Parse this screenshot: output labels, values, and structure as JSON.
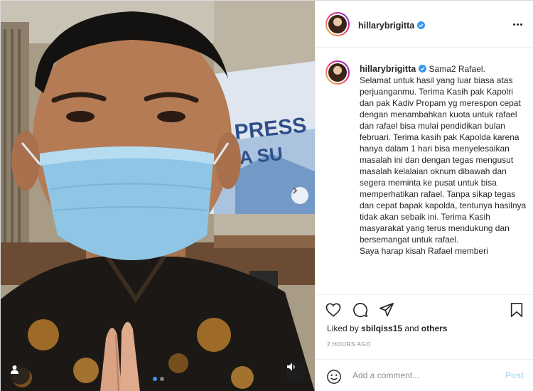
{
  "post": {
    "username": "hillarybrigitta",
    "verified": true,
    "more_icon": "more-options-icon"
  },
  "caption": {
    "username": "hillarybrigitta",
    "text": "Sama2 Rafael.\nSelamat untuk hasil yang luar biasa atas perjuanganmu. Terima Kasih pak Kapolri dan pak Kadiv Propam yg merespon cepat dengan menambahkan kuota untuk rafael dan rafael bisa mulai pendidikan bulan februari. Terima kasih pak Kapolda karena hanya dalam 1 hari bisa menyelesaikan masalah ini dan dengan tegas mengusut masalah kelalaian oknum dibawah dan segera meminta ke pusat untuk bisa memperhatikan rafael. Tanpa sikap tegas dan cepat bapak kapolda, tentunya hasilnya tidak akan sebaik ini. Terima Kasih masyarakat yang terus mendukung dan bersemangat untuk rafael.\nSaya harap kisah Rafael memberi"
  },
  "media": {
    "banner_lines": [
      "PRESS",
      "DA SU"
    ],
    "carousel_count": 2,
    "carousel_active": 0
  },
  "actions": {
    "icons": [
      "heart-icon",
      "comment-icon",
      "share-icon",
      "bookmark-icon"
    ]
  },
  "likes": {
    "prefix": "Liked by",
    "user": "sbilqiss15",
    "connector": "and",
    "others": "others"
  },
  "timestamp": "2 HOURS AGO",
  "comment_box": {
    "placeholder": "Add a comment...",
    "post_label": "Post"
  },
  "colors": {
    "accent": "#3897f0",
    "post_disabled": "#b2dffc",
    "muted": "#8e8e8e",
    "text": "#262626"
  }
}
